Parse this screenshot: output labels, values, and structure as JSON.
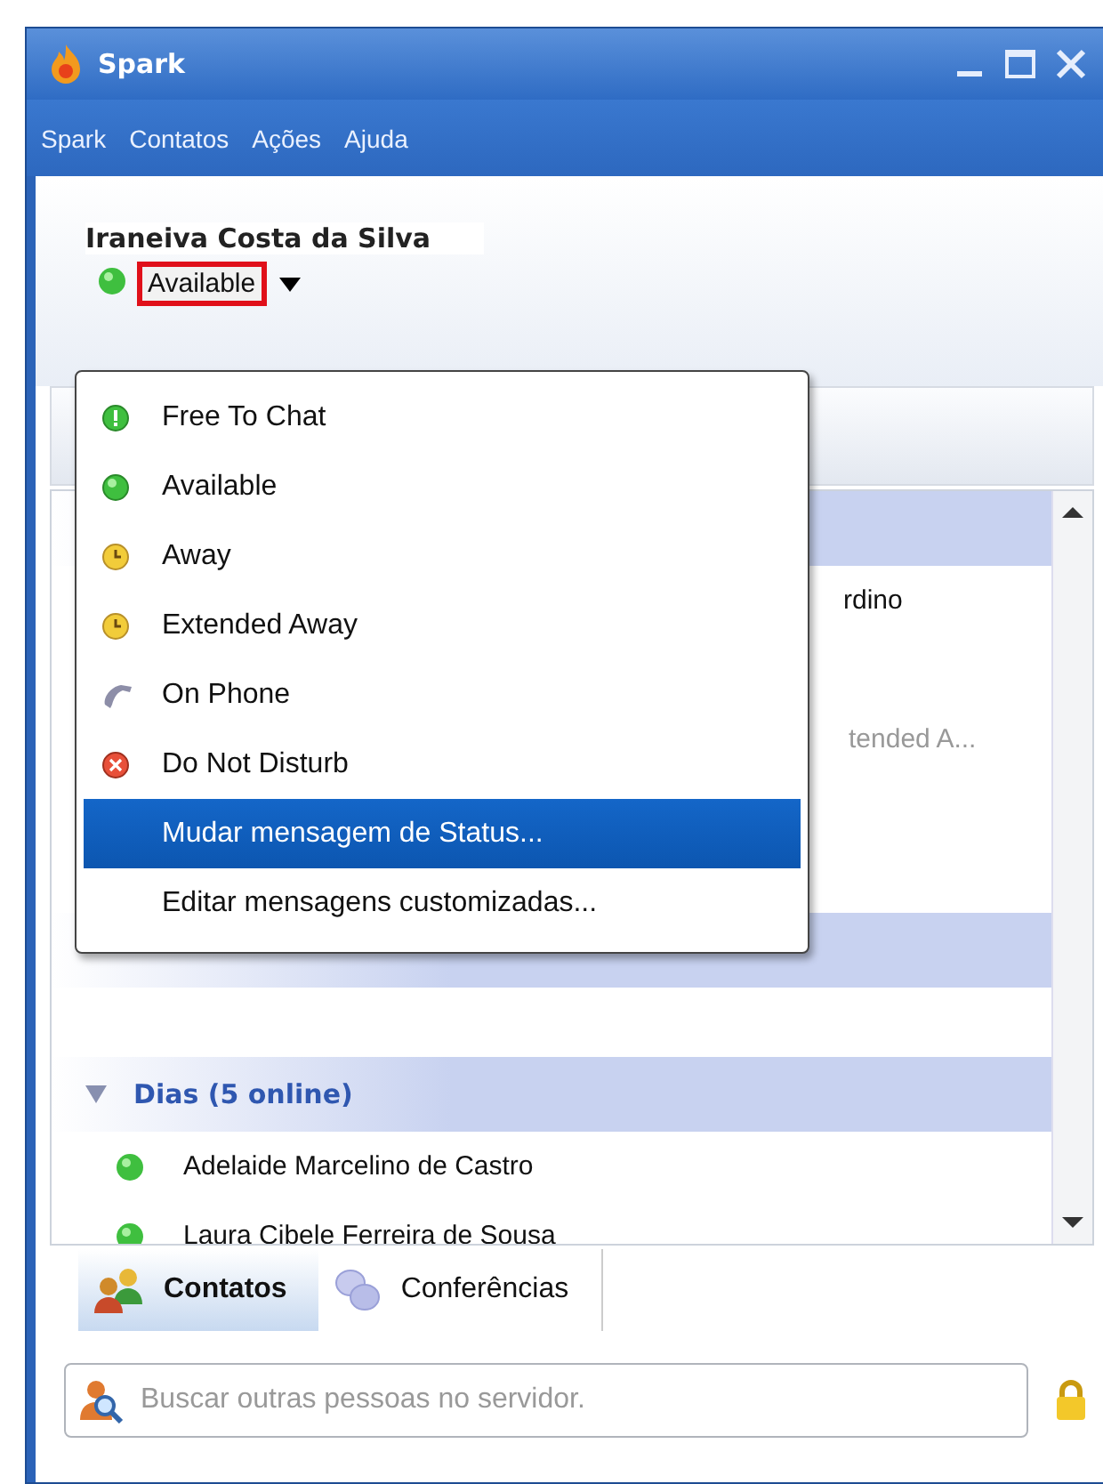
{
  "window": {
    "title": "Spark"
  },
  "menubar": [
    {
      "label": "Spark"
    },
    {
      "label": "Contatos"
    },
    {
      "label": "Ações"
    },
    {
      "label": "Ajuda"
    }
  ],
  "user": {
    "name": "Iraneiva Costa da Silva",
    "status": "Available",
    "color": "#3fbf3f"
  },
  "status_menu": [
    {
      "label": "Free To Chat",
      "kind": "chat",
      "selected": false
    },
    {
      "label": "Available",
      "kind": "available",
      "selected": false
    },
    {
      "label": "Away",
      "kind": "away",
      "selected": false
    },
    {
      "label": "Extended Away",
      "kind": "away",
      "selected": false
    },
    {
      "label": "On Phone",
      "kind": "phone",
      "selected": false
    },
    {
      "label": "Do Not Disturb",
      "kind": "dnd",
      "selected": false
    },
    {
      "label": "Mudar mensagem de Status...",
      "kind": "action",
      "selected": true
    },
    {
      "label": "Editar mensagens customizadas...",
      "kind": "action",
      "selected": false
    }
  ],
  "contact_list": [
    {
      "kind": "group"
    },
    {
      "kind": "contact",
      "name_tail": "rdino"
    },
    {
      "kind": "contact"
    },
    {
      "kind": "contact",
      "status_tail": "tended A..."
    },
    {
      "kind": "contact"
    },
    {
      "kind": "contact"
    },
    {
      "kind": "group"
    },
    {
      "kind": "contact"
    },
    {
      "kind": "group",
      "name": "Dias (5 online)",
      "expanded": true
    },
    {
      "kind": "contact",
      "name": "Adelaide Marcelino de Castro",
      "color": "#3fbf3f"
    },
    {
      "kind": "contact",
      "name": "Laura Cibele Ferreira de Sousa",
      "color": "#3fbf3f"
    }
  ],
  "tabs": [
    {
      "label": "Contatos",
      "selected": true
    },
    {
      "label": "Conferências",
      "selected": false
    }
  ],
  "search": {
    "placeholder": "Buscar outras pessoas no servidor."
  }
}
